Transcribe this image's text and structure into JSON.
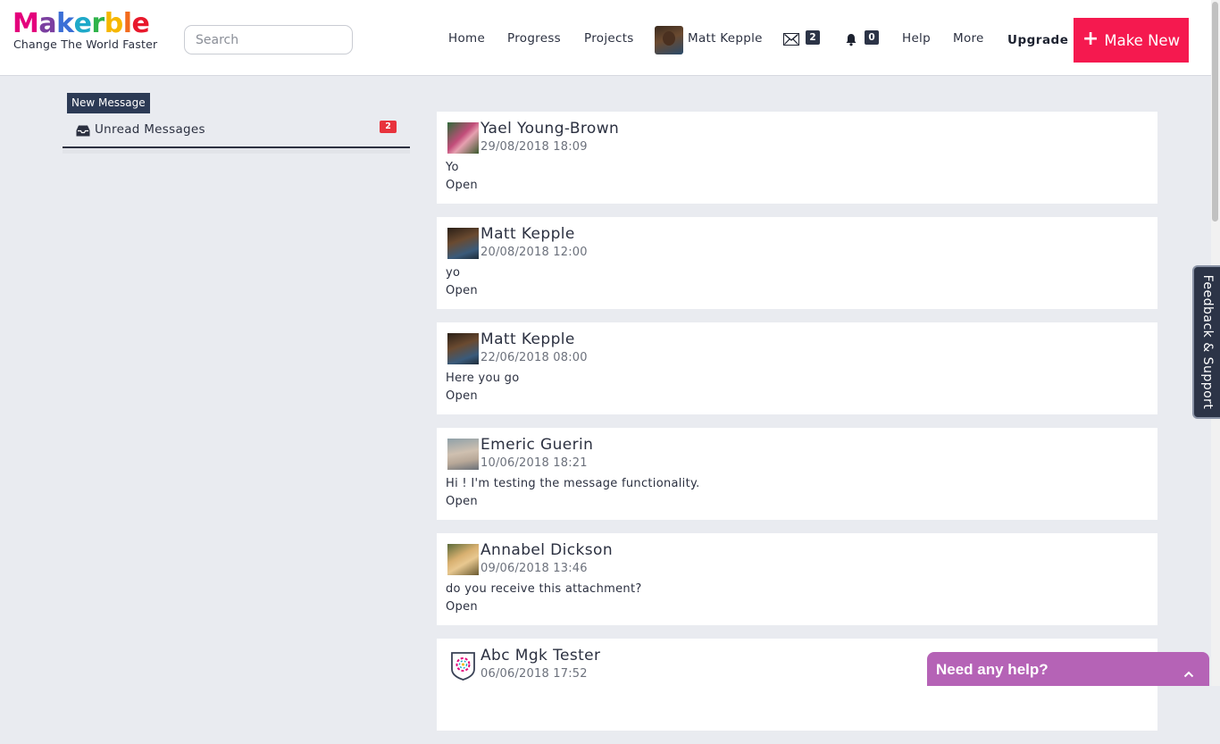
{
  "header": {
    "logo_letters": [
      "M",
      "a",
      "k",
      "e",
      "r",
      "b",
      "l",
      "e"
    ],
    "logo_colors": [
      "#e4007c",
      "#7b3fa0",
      "#3b6fd6",
      "#1fa9c9",
      "#2fb34a",
      "#f6b700",
      "#f26b1d",
      "#e8192c"
    ],
    "tagline": "Change The World Faster",
    "search_placeholder": "Search",
    "nav": {
      "home": "Home",
      "progress": "Progress",
      "projects": "Projects",
      "user_name": "Matt Kepple",
      "messages_count": "2",
      "notifications_count": "0",
      "help": "Help",
      "more": "More",
      "upgrade": "Upgrade",
      "make_new": "Make New"
    },
    "accent_color": "#f5194f"
  },
  "sidebar": {
    "new_message": "New Message",
    "unread_label": "Unread Messages",
    "unread_count": "2"
  },
  "messages": [
    {
      "name": "Yael Young-Brown",
      "date": "29/08/2018 18:09",
      "text": "Yo",
      "action": "Open",
      "avatar": "photo"
    },
    {
      "name": "Matt Kepple",
      "date": "20/08/2018 12:00",
      "text": "yo",
      "action": "Open",
      "avatar": "photo"
    },
    {
      "name": "Matt Kepple",
      "date": "22/06/2018 08:00",
      "text": "Here you go",
      "action": "Open",
      "avatar": "photo"
    },
    {
      "name": "Emeric Guerin",
      "date": "10/06/2018 18:21",
      "text": "Hi ! I'm testing the message functionality.",
      "action": "Open",
      "avatar": "photo"
    },
    {
      "name": "Annabel Dickson",
      "date": "09/06/2018 13:46",
      "text": "do you receive this attachment?",
      "action": "Open",
      "avatar": "photo"
    },
    {
      "name": "Abc Mgk Tester",
      "date": "06/06/2018 17:52",
      "text": "",
      "action": "",
      "avatar": "shield-logo"
    }
  ],
  "feedback_tab": "Feedback & Support",
  "help_widget": "Need any help?"
}
